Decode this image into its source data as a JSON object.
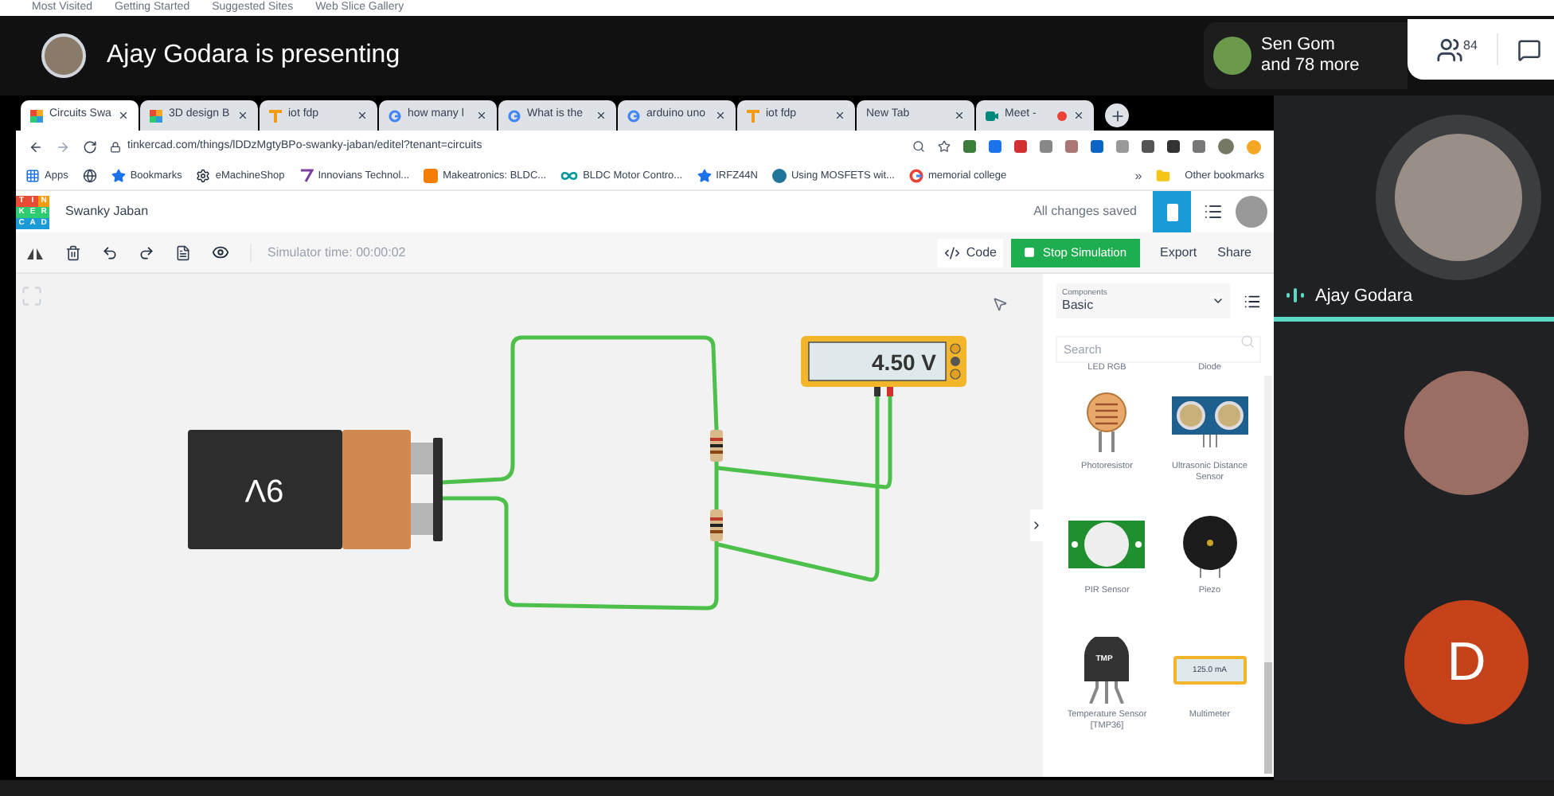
{
  "bookmark_strip": [
    "Most Visited",
    "Getting Started",
    "Suggested Sites",
    "Web Slice Gallery"
  ],
  "meet_header": {
    "presenter": "Ajay Godara is presenting",
    "others_name": "Sen Gom",
    "others_more": "and 78 more",
    "people_count": "84"
  },
  "browser": {
    "tabs": [
      {
        "label": "Circuits Swa",
        "kind": "tinkercad",
        "selected": true
      },
      {
        "label": "3D design B",
        "kind": "tinkercad",
        "selected": false
      },
      {
        "label": "iot fdp",
        "kind": "t",
        "selected": false
      },
      {
        "label": "how many l",
        "kind": "g",
        "selected": false
      },
      {
        "label": "What is the",
        "kind": "g",
        "selected": false
      },
      {
        "label": "arduino uno",
        "kind": "g",
        "selected": false
      },
      {
        "label": "iot fdp",
        "kind": "t",
        "selected": false
      },
      {
        "label": "New Tab",
        "kind": "plain",
        "selected": false
      },
      {
        "label": "Meet -",
        "kind": "meet",
        "selected": false,
        "recording": true
      }
    ],
    "url": "tinkercad.com/things/lDDzMgtyBPo-swanky-jaban/editel?tenant=circuits",
    "bookmarks": [
      {
        "kind": "apps",
        "label": "Apps"
      },
      {
        "kind": "globe"
      },
      {
        "kind": "star",
        "label": "Bookmarks"
      },
      {
        "kind": "gear",
        "label": "eMachineShop"
      },
      {
        "kind": "inno",
        "label": "Innovians Technol..."
      },
      {
        "kind": "blogger",
        "label": "Makeatronics: BLDC..."
      },
      {
        "kind": "infinity",
        "label": "BLDC Motor Contro..."
      },
      {
        "kind": "star",
        "label": "IRFZ44N"
      },
      {
        "kind": "wordpress",
        "label": "Using MOSFETS wit..."
      },
      {
        "kind": "google",
        "label": "memorial college"
      }
    ],
    "more": "»",
    "other_bookmarks": "Other bookmarks"
  },
  "tinkercad": {
    "logo": [
      "T",
      "I",
      "N",
      "K",
      "E",
      "R",
      "C",
      "A",
      "D"
    ],
    "title": "Swanky Jaban",
    "save_status": "All changes saved",
    "simulator_time": "Simulator time: 00:00:02",
    "code_button": "Code",
    "stop_button": "Stop Simulation",
    "export_button": "Export",
    "share_button": "Share",
    "battery_label": "9V",
    "meter_reading": "4.50 V",
    "components": {
      "caption": "Components",
      "category": "Basic",
      "search_placeholder": "Search",
      "top_labels": [
        "LED RGB",
        "Diode"
      ],
      "items": [
        {
          "kind": "photoresistor",
          "label": "Photoresistor"
        },
        {
          "kind": "ultrasonic",
          "label": "Ultrasonic Distance Sensor"
        },
        {
          "kind": "pir",
          "label": "PIR Sensor"
        },
        {
          "kind": "piezo",
          "label": "Piezo"
        },
        {
          "kind": "tmp",
          "label": "Temperature Sensor [TMP36]",
          "icon_text": "TMP"
        },
        {
          "kind": "multimeter",
          "label": "Multimeter",
          "icon_text": "125.0 mA"
        }
      ]
    }
  },
  "participants": [
    {
      "kind": "photo",
      "name": "Ajay Godara",
      "speaking": true
    },
    {
      "kind": "photo",
      "speaking": false
    },
    {
      "kind": "initial",
      "initial": "D",
      "speaking": false
    }
  ]
}
